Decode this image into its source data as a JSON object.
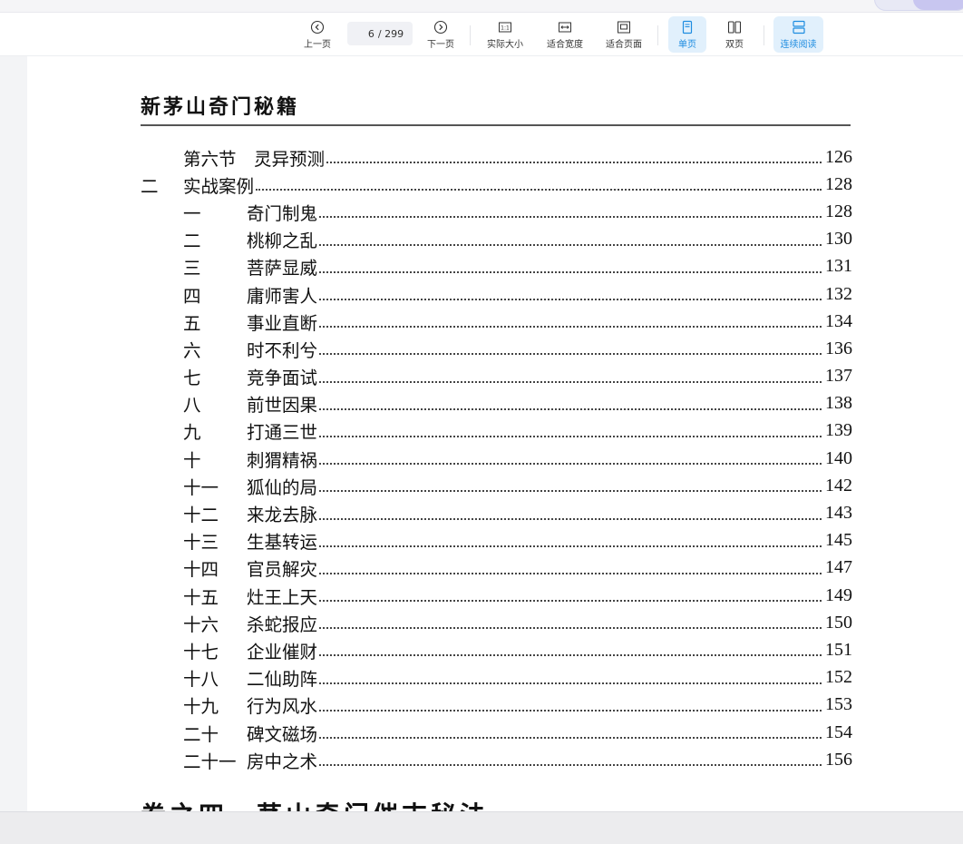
{
  "toolbar": {
    "prev_label": "上一页",
    "current_page": "6",
    "total_pages": "/ 299",
    "next_label": "下一页",
    "actual_size_label": "实际大小",
    "fit_width_label": "适合宽度",
    "fit_page_label": "适合页面",
    "single_page_label": "单页",
    "double_page_label": "双页",
    "continuous_label": "连续阅读",
    "accent_color": "#1d8ce0"
  },
  "document": {
    "running_head": "新茅山奇门秘籍",
    "toc": [
      {
        "level": 1,
        "num": "",
        "title": "第六节　灵异预测",
        "page": "126"
      },
      {
        "level": 0,
        "num": "二",
        "title": "实战案例",
        "page": "128"
      },
      {
        "level": 2,
        "num": "一",
        "title": "奇门制鬼",
        "page": "128"
      },
      {
        "level": 2,
        "num": "二",
        "title": "桃柳之乱",
        "page": "130"
      },
      {
        "level": 2,
        "num": "三",
        "title": "菩萨显威",
        "page": "131"
      },
      {
        "level": 2,
        "num": "四",
        "title": "庸师害人",
        "page": "132"
      },
      {
        "level": 2,
        "num": "五",
        "title": "事业直断",
        "page": "134"
      },
      {
        "level": 2,
        "num": "六",
        "title": "时不利兮",
        "page": "136"
      },
      {
        "level": 2,
        "num": "七",
        "title": "竞争面试",
        "page": "137"
      },
      {
        "level": 2,
        "num": "八",
        "title": "前世因果",
        "page": "138"
      },
      {
        "level": 2,
        "num": "九",
        "title": "打通三世",
        "page": "139"
      },
      {
        "level": 2,
        "num": "十",
        "title": "刺猬精祸",
        "page": "140"
      },
      {
        "level": 2,
        "num": "十一",
        "title": "狐仙的局",
        "page": "142"
      },
      {
        "level": 2,
        "num": "十二",
        "title": "来龙去脉",
        "page": "143"
      },
      {
        "level": 2,
        "num": "十三",
        "title": "生基转运",
        "page": "145"
      },
      {
        "level": 2,
        "num": "十四",
        "title": "官员解灾",
        "page": "147"
      },
      {
        "level": 2,
        "num": "十五",
        "title": "灶王上天",
        "page": "149"
      },
      {
        "level": 2,
        "num": "十六",
        "title": "杀蛇报应",
        "page": "150"
      },
      {
        "level": 2,
        "num": "十七",
        "title": "企业催财",
        "page": "151"
      },
      {
        "level": 2,
        "num": "十八",
        "title": "二仙助阵",
        "page": "152"
      },
      {
        "level": 2,
        "num": "十九",
        "title": "行为风水",
        "page": "153"
      },
      {
        "level": 2,
        "num": "二十",
        "title": "碑文磁场",
        "page": "154"
      },
      {
        "level": 2,
        "num": "二十一",
        "title": "房中之术",
        "page": "156"
      }
    ],
    "next_heading": "卷之四　茅山奇门催吉秘法"
  }
}
